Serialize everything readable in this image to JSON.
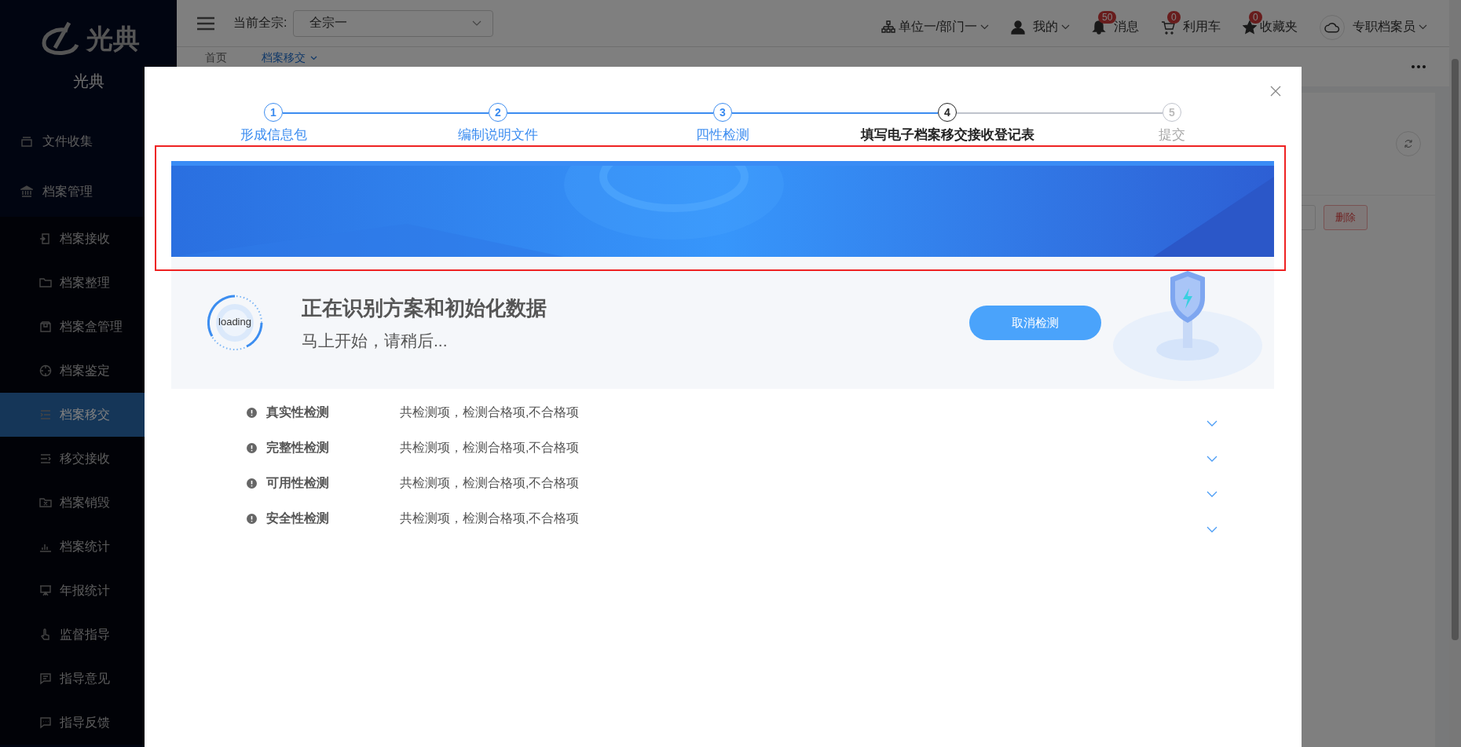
{
  "sidebar": {
    "logo_text": "光典",
    "caption": "光典",
    "items": [
      {
        "label": "文件收集",
        "selected": false
      },
      {
        "label": "档案管理",
        "selected": false,
        "children": [
          {
            "label": "档案接收",
            "selected": false
          },
          {
            "label": "档案整理",
            "selected": false
          },
          {
            "label": "档案盒管理",
            "selected": false
          },
          {
            "label": "档案鉴定",
            "selected": false
          },
          {
            "label": "档案移交",
            "selected": true
          },
          {
            "label": "移交接收",
            "selected": false
          },
          {
            "label": "档案销毁",
            "selected": false
          },
          {
            "label": "档案统计",
            "selected": false
          },
          {
            "label": "年报统计",
            "selected": false
          },
          {
            "label": "监督指导",
            "selected": false
          },
          {
            "label": "指导意见",
            "selected": false
          },
          {
            "label": "指导反馈",
            "selected": false
          }
        ]
      }
    ]
  },
  "header": {
    "fonds_label": "当前全宗:",
    "fonds_value": "全宗一",
    "items": [
      {
        "kind": "org",
        "label": "单位一/部门一",
        "dropdown": true
      },
      {
        "kind": "user",
        "label": "我的",
        "dropdown": true
      },
      {
        "kind": "bell",
        "label": "消息",
        "badge": "50",
        "dropdown": false
      },
      {
        "kind": "cart",
        "label": "利用车",
        "badge": "0",
        "dropdown": false
      },
      {
        "kind": "star",
        "label": "收藏夹",
        "badge": "0",
        "dropdown": false
      },
      {
        "kind": "cloud",
        "label": "专职档案员",
        "dropdown": true
      }
    ]
  },
  "tabs": [
    {
      "label": "首页",
      "selected": false
    },
    {
      "label": "档案移交",
      "selected": true
    }
  ],
  "background": {
    "delete_button": "删除"
  },
  "modal": {
    "steps": [
      {
        "number": "1",
        "label": "形成信息包",
        "completed": true,
        "selected": false
      },
      {
        "number": "2",
        "label": "编制说明文件",
        "completed": true,
        "selected": false
      },
      {
        "number": "3",
        "label": "四性检测",
        "completed": true,
        "selected": false
      },
      {
        "number": "4",
        "label": "填写电子档案移交接收登记表",
        "completed": false,
        "selected": true
      },
      {
        "number": "5",
        "label": "提交",
        "completed": false,
        "selected": false
      }
    ],
    "loading": {
      "spinner_text": "loading",
      "title": "正在识别方案和初始化数据",
      "subtitle": "马上开始，请稍后...",
      "cancel_button": "取消检测"
    },
    "checks": [
      {
        "label": "真实性检测",
        "summary": "共检测项，检测合格项,不合格项"
      },
      {
        "label": "完整性检测",
        "summary": "共检测项，检测合格项,不合格项"
      },
      {
        "label": "可用性检测",
        "summary": "共检测项，检测合格项,不合格项"
      },
      {
        "label": "安全性检测",
        "summary": "共检测项，检测合格项,不合格项"
      }
    ]
  }
}
